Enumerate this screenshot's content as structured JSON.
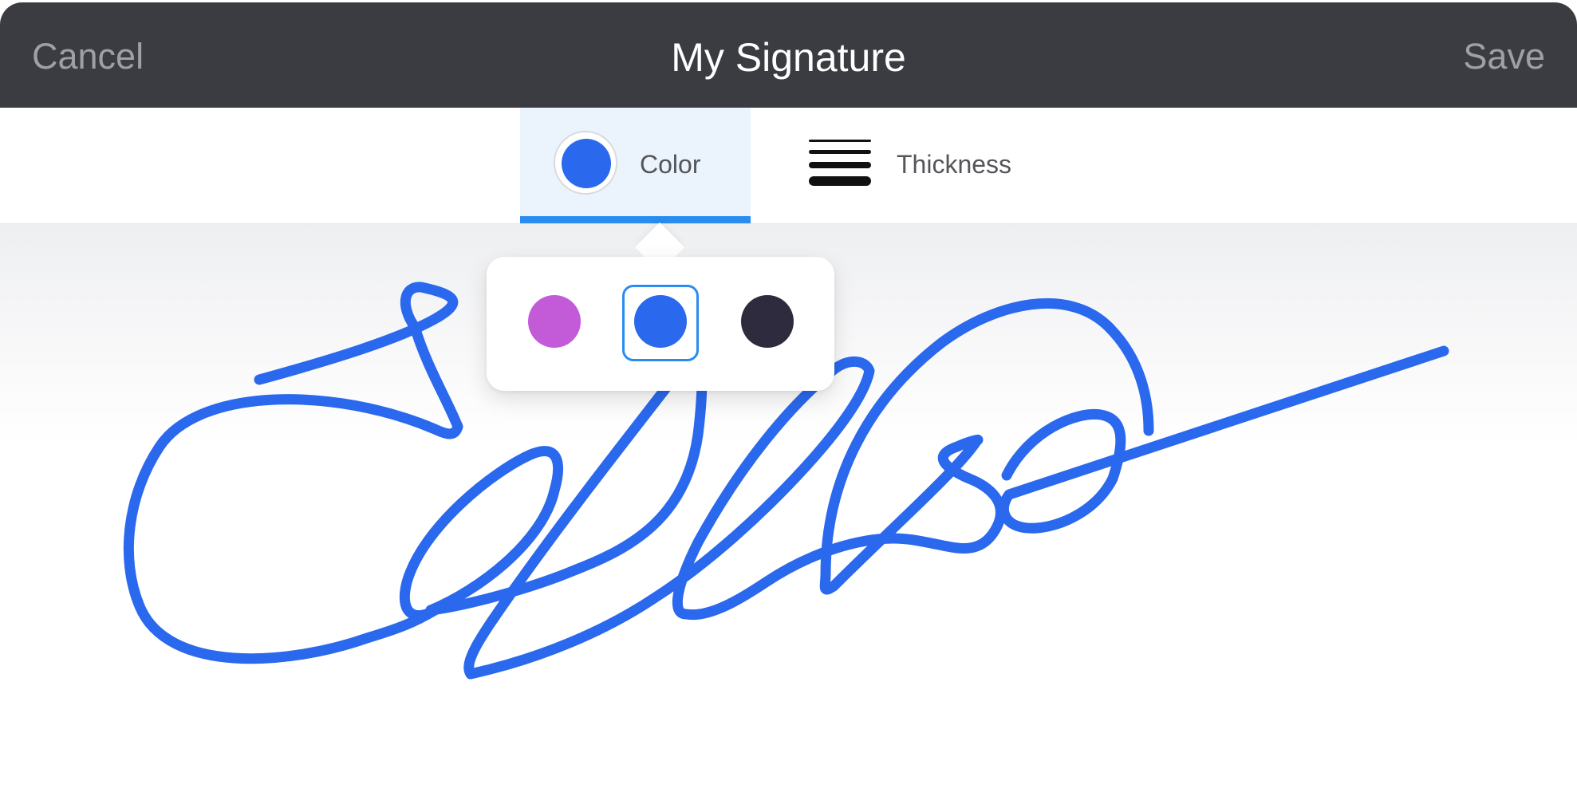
{
  "header": {
    "cancel_label": "Cancel",
    "title": "My Signature",
    "save_label": "Save"
  },
  "toolbar": {
    "color_tab_label": "Color",
    "thickness_tab_label": "Thickness",
    "active_tab": "Color",
    "current_color": "#2a68ed",
    "thickness_icon": "line-weight-icon"
  },
  "color_picker": {
    "options": [
      {
        "name": "magenta",
        "hex": "#c35bd8",
        "selected": false
      },
      {
        "name": "blue",
        "hex": "#2a68ed",
        "selected": true
      },
      {
        "name": "dark",
        "hex": "#2e2b3e",
        "selected": false
      }
    ]
  },
  "signature": {
    "stroke_color": "#2a68ed"
  },
  "colors": {
    "header_bg": "#3b3c41",
    "accent": "#2b8cf0",
    "tab_active_bg": "#ebf3fc"
  }
}
